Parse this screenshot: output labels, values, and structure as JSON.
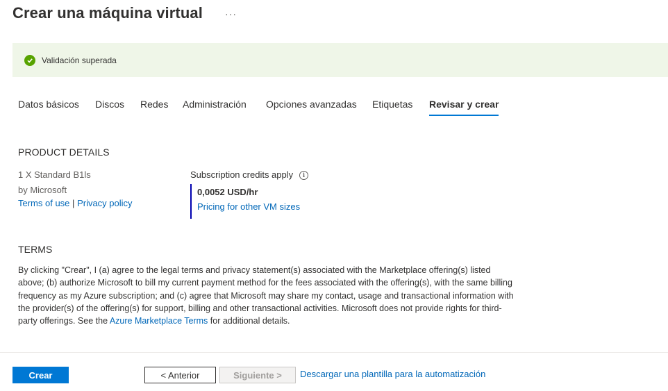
{
  "header": {
    "title": "Crear una máquina virtual",
    "more_label": "···"
  },
  "banner": {
    "text": "Validación superada",
    "status_color": "#57a300",
    "icon": "check-circle-icon"
  },
  "tabs": [
    {
      "label": "Datos básicos"
    },
    {
      "label": "Discos"
    },
    {
      "label": "Redes"
    },
    {
      "label": "Administración"
    },
    {
      "label": "Opciones avanzadas"
    },
    {
      "label": "Etiquetas"
    },
    {
      "label": "Revisar y crear",
      "active": true
    }
  ],
  "product": {
    "section_title": "PRODUCT DETAILS",
    "name": "1 X Standard B1ls",
    "publisher": "by Microsoft",
    "terms_link": "Terms of use",
    "separator": "|",
    "privacy_link": "Privacy policy",
    "credits_label": "Subscription credits apply",
    "price": "0,0052 USD/hr",
    "pricing_link": "Pricing for other VM sizes"
  },
  "terms": {
    "section_title": "TERMS",
    "text_before": "By clicking \"Crear\", I (a) agree to the legal terms and privacy statement(s) associated with the Marketplace offering(s) listed above; (b) authorize Microsoft to bill my current payment method for the fees associated with the offering(s), with the same billing frequency as my Azure subscription; and (c) agree that Microsoft may share my contact, usage and transactional information with the provider(s) of the offering(s) for support, billing and other transactional activities. Microsoft does not provide rights for third-party offerings. See the ",
    "link": "Azure Marketplace Terms",
    "text_after": " for additional details."
  },
  "footer": {
    "create_label": "Crear",
    "previous_label": "< Anterior",
    "next_label": "Siguiente >",
    "download_link": "Descargar una plantilla para la automatización"
  },
  "colors": {
    "accent": "#0078d4",
    "link": "#0067b8",
    "banner_bg": "#eff6e8"
  }
}
